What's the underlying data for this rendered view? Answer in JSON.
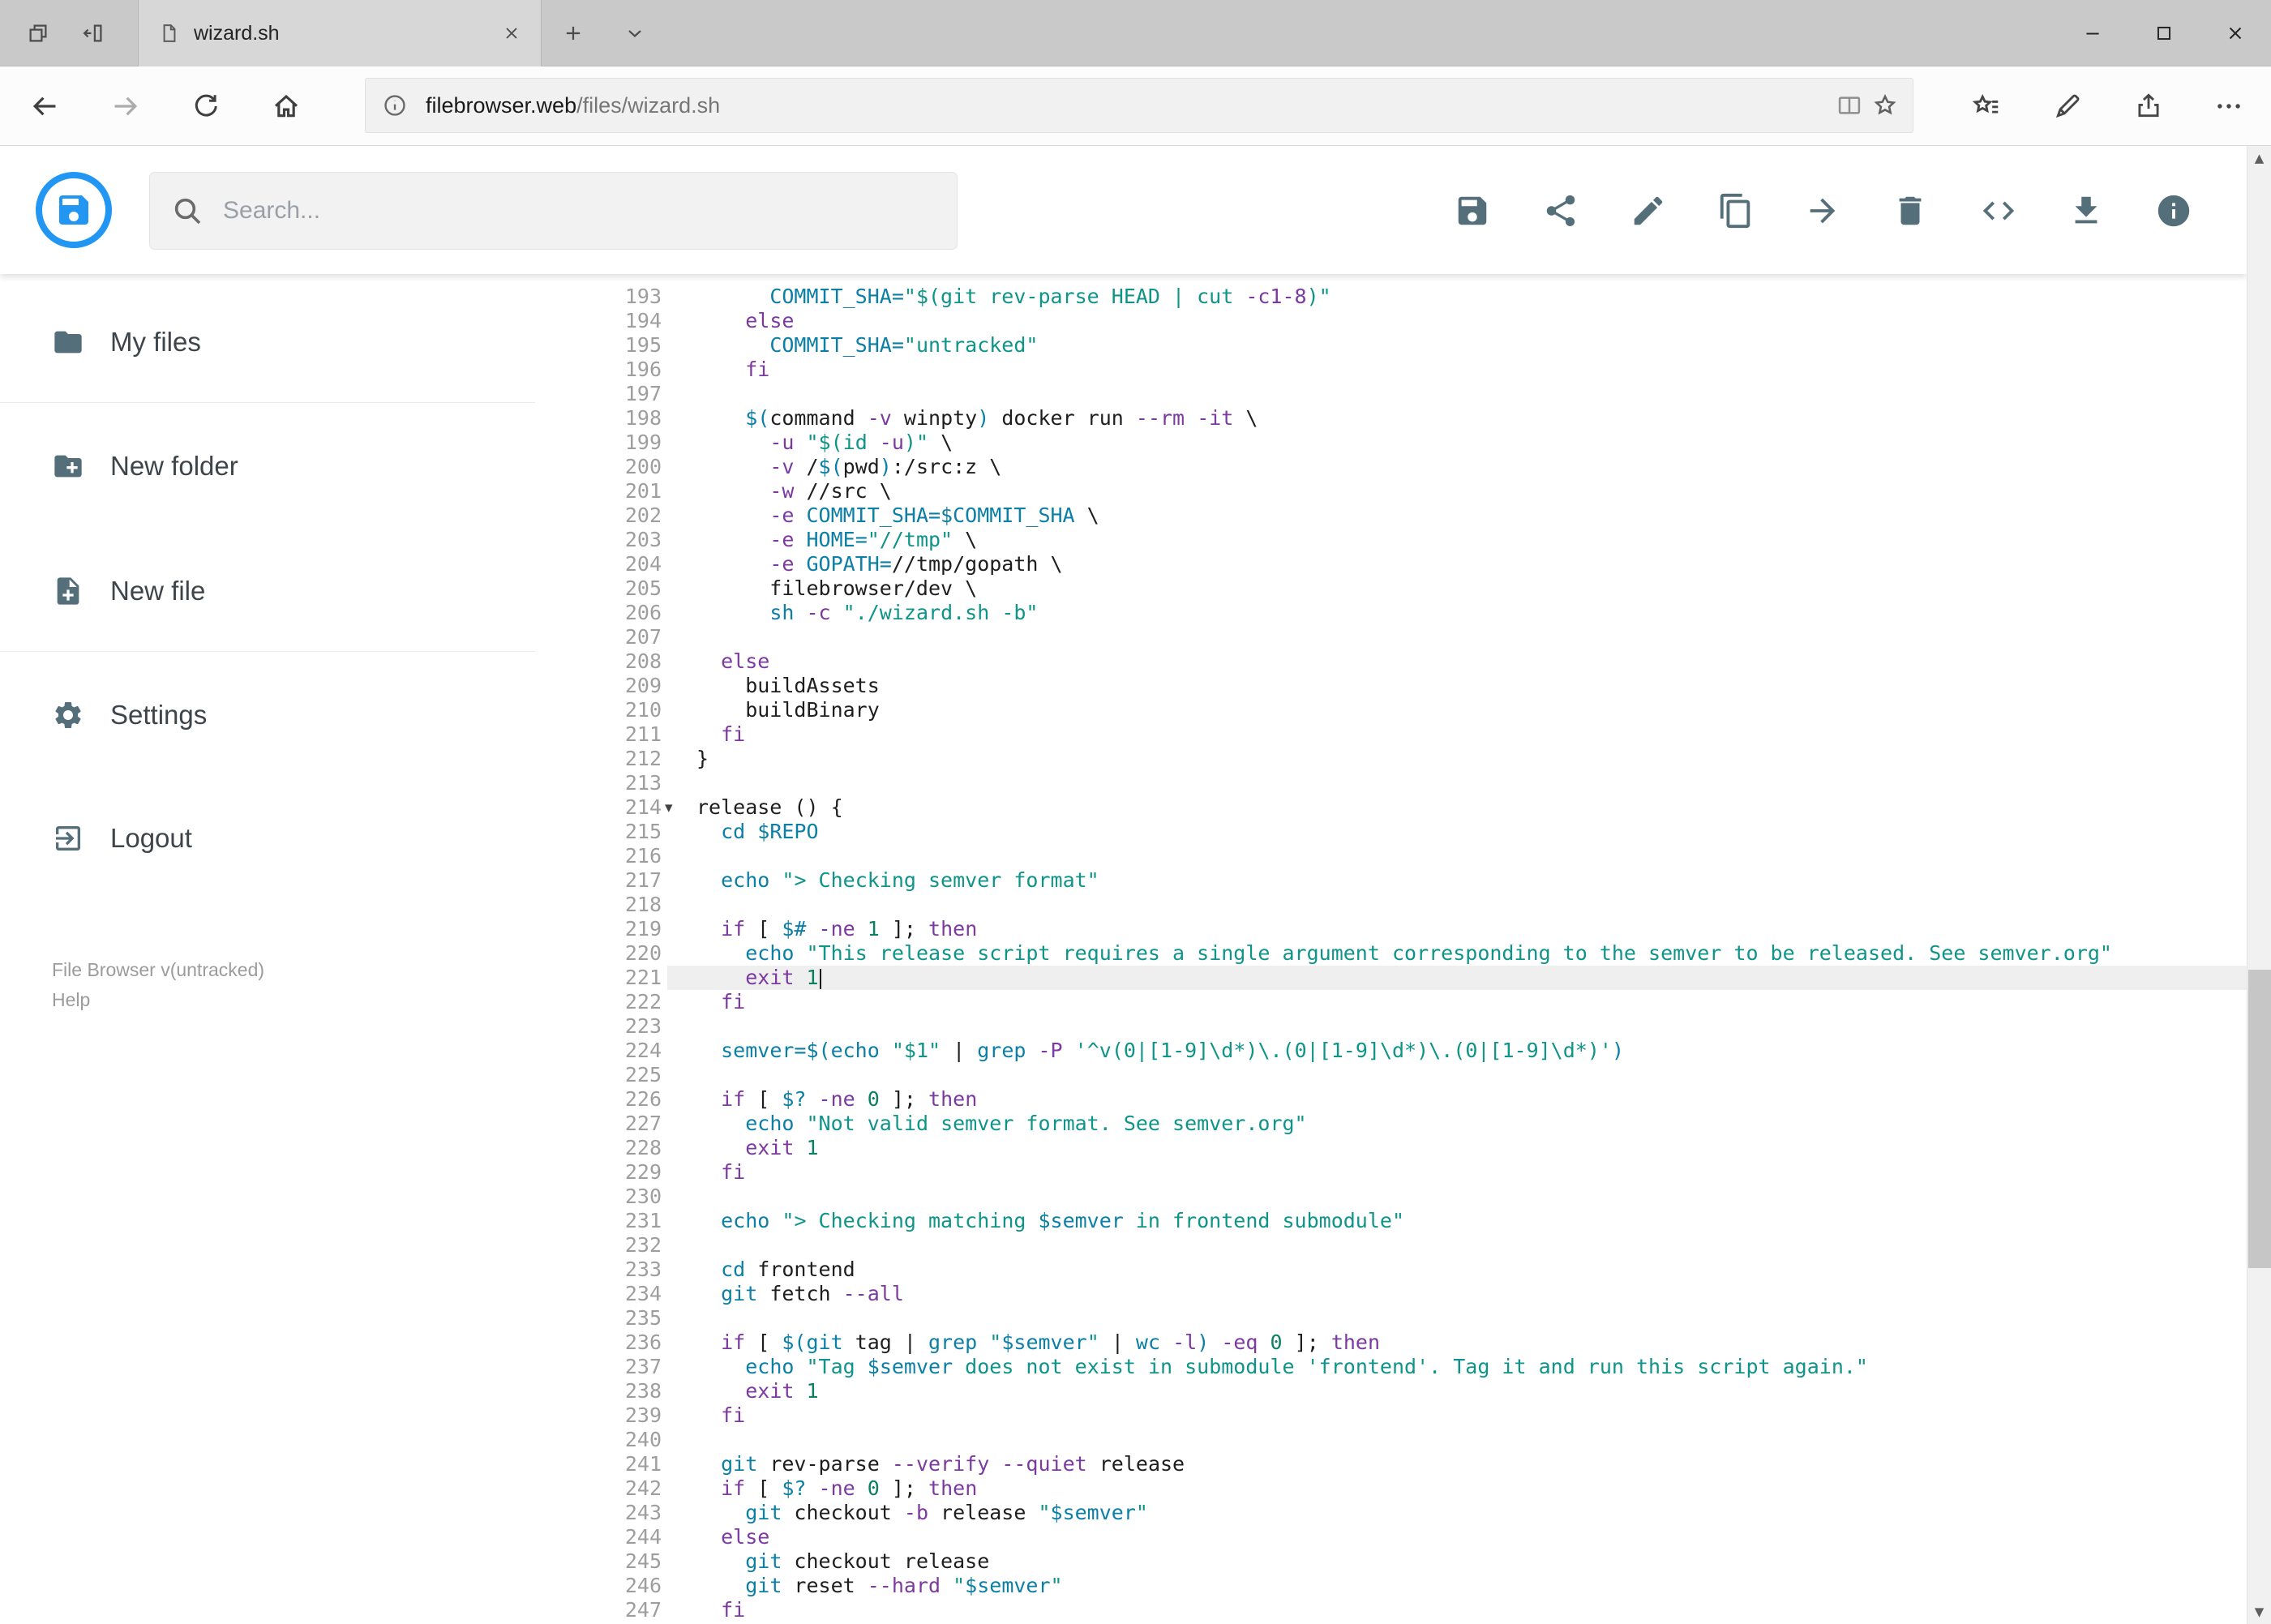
{
  "browser": {
    "tab_title": "wizard.sh",
    "url_domain": "filebrowser.web",
    "url_path": "/files/wizard.sh"
  },
  "app": {
    "search_placeholder": "Search...",
    "toolbar_icons": [
      "save",
      "share",
      "edit",
      "copy",
      "move",
      "delete",
      "raw-code",
      "download",
      "info"
    ],
    "sidebar": {
      "items": [
        {
          "label": "My files",
          "icon": "folder"
        },
        {
          "label": "New folder",
          "icon": "create-new-folder"
        },
        {
          "label": "New file",
          "icon": "new-file"
        },
        {
          "label": "Settings",
          "icon": "settings"
        },
        {
          "label": "Logout",
          "icon": "logout"
        }
      ],
      "footer_version": "File Browser v(untracked)",
      "footer_help": "Help"
    }
  },
  "colors": {
    "accent_blue": "#2196f3",
    "icon_gray": "#546e7a",
    "syntax_keyword": "#7c3aa0",
    "syntax_string": "#0f9489",
    "syntax_variable": "#0c7fa6",
    "syntax_number": "#0d7f62",
    "line_number_gray": "#9e9e9e",
    "active_line_bg": "#efefef"
  },
  "editor": {
    "active_line": 221,
    "fold_markers": [
      214
    ],
    "lines": [
      {
        "n": 193,
        "t": [
          [
            "p",
            "      "
          ],
          [
            "v",
            "COMMIT_SHA="
          ],
          [
            "s",
            "\"$(git rev-parse HEAD | cut "
          ],
          [
            "k",
            "-c1-8"
          ],
          [
            "s",
            ")\""
          ]
        ]
      },
      {
        "n": 194,
        "t": [
          [
            "p",
            "    "
          ],
          [
            "k",
            "else"
          ]
        ]
      },
      {
        "n": 195,
        "t": [
          [
            "p",
            "      "
          ],
          [
            "v",
            "COMMIT_SHA="
          ],
          [
            "s",
            "\"untracked\""
          ]
        ]
      },
      {
        "n": 196,
        "t": [
          [
            "p",
            "    "
          ],
          [
            "k",
            "fi"
          ]
        ]
      },
      {
        "n": 197,
        "t": []
      },
      {
        "n": 198,
        "t": [
          [
            "p",
            "    "
          ],
          [
            "v",
            "$("
          ],
          [
            "p",
            "command "
          ],
          [
            "k",
            "-v"
          ],
          [
            "p",
            " winpty"
          ],
          [
            "v",
            ")"
          ],
          [
            "p",
            " docker run "
          ],
          [
            "k",
            "--rm"
          ],
          [
            "p",
            " "
          ],
          [
            "k",
            "-it"
          ],
          [
            "p",
            " \\"
          ]
        ]
      },
      {
        "n": 199,
        "t": [
          [
            "p",
            "      "
          ],
          [
            "k",
            "-u"
          ],
          [
            "p",
            " "
          ],
          [
            "s",
            "\"$(id "
          ],
          [
            "k",
            "-u"
          ],
          [
            "s",
            ")\""
          ],
          [
            "p",
            " \\"
          ]
        ]
      },
      {
        "n": 200,
        "t": [
          [
            "p",
            "      "
          ],
          [
            "k",
            "-v"
          ],
          [
            "p",
            " /"
          ],
          [
            "v",
            "$("
          ],
          [
            "p",
            "pwd"
          ],
          [
            "v",
            ")"
          ],
          [
            "p",
            ":/src:z \\"
          ]
        ]
      },
      {
        "n": 201,
        "t": [
          [
            "p",
            "      "
          ],
          [
            "k",
            "-w"
          ],
          [
            "p",
            " //src \\"
          ]
        ]
      },
      {
        "n": 202,
        "t": [
          [
            "p",
            "      "
          ],
          [
            "k",
            "-e"
          ],
          [
            "p",
            " "
          ],
          [
            "v",
            "COMMIT_SHA=$COMMIT_SHA"
          ],
          [
            "p",
            " \\"
          ]
        ]
      },
      {
        "n": 203,
        "t": [
          [
            "p",
            "      "
          ],
          [
            "k",
            "-e"
          ],
          [
            "p",
            " "
          ],
          [
            "v",
            "HOME="
          ],
          [
            "s",
            "\"//tmp\""
          ],
          [
            "p",
            " \\"
          ]
        ]
      },
      {
        "n": 204,
        "t": [
          [
            "p",
            "      "
          ],
          [
            "k",
            "-e"
          ],
          [
            "p",
            " "
          ],
          [
            "v",
            "GOPATH="
          ],
          [
            "p",
            "//tmp/gopath \\"
          ]
        ]
      },
      {
        "n": 205,
        "t": [
          [
            "p",
            "      filebrowser/dev \\"
          ]
        ]
      },
      {
        "n": 206,
        "t": [
          [
            "p",
            "      "
          ],
          [
            "v",
            "sh"
          ],
          [
            "p",
            " "
          ],
          [
            "k",
            "-c"
          ],
          [
            "p",
            " "
          ],
          [
            "s",
            "\"./wizard.sh -b\""
          ]
        ]
      },
      {
        "n": 207,
        "t": []
      },
      {
        "n": 208,
        "t": [
          [
            "p",
            "  "
          ],
          [
            "k",
            "else"
          ]
        ]
      },
      {
        "n": 209,
        "t": [
          [
            "p",
            "    buildAssets"
          ]
        ]
      },
      {
        "n": 210,
        "t": [
          [
            "p",
            "    buildBinary"
          ]
        ]
      },
      {
        "n": 211,
        "t": [
          [
            "p",
            "  "
          ],
          [
            "k",
            "fi"
          ]
        ]
      },
      {
        "n": 212,
        "t": [
          [
            "p",
            "}"
          ]
        ]
      },
      {
        "n": 213,
        "t": []
      },
      {
        "n": 214,
        "t": [
          [
            "p",
            "release () {"
          ]
        ]
      },
      {
        "n": 215,
        "t": [
          [
            "p",
            "  "
          ],
          [
            "v",
            "cd $REPO"
          ]
        ]
      },
      {
        "n": 216,
        "t": []
      },
      {
        "n": 217,
        "t": [
          [
            "p",
            "  "
          ],
          [
            "v",
            "echo"
          ],
          [
            "p",
            " "
          ],
          [
            "s",
            "\"> Checking semver format\""
          ]
        ]
      },
      {
        "n": 218,
        "t": []
      },
      {
        "n": 219,
        "t": [
          [
            "p",
            "  "
          ],
          [
            "k",
            "if"
          ],
          [
            "p",
            " [ "
          ],
          [
            "v",
            "$#"
          ],
          [
            "p",
            " "
          ],
          [
            "k",
            "-ne"
          ],
          [
            "p",
            " "
          ],
          [
            "n",
            "1"
          ],
          [
            "p",
            " ]; "
          ],
          [
            "k",
            "then"
          ]
        ]
      },
      {
        "n": 220,
        "t": [
          [
            "p",
            "    "
          ],
          [
            "v",
            "echo"
          ],
          [
            "p",
            " "
          ],
          [
            "s",
            "\"This release script requires a single argument corresponding to the semver to be released. See semver.org\""
          ]
        ]
      },
      {
        "n": 221,
        "t": [
          [
            "p",
            "    "
          ],
          [
            "k",
            "exit"
          ],
          [
            "p",
            " "
          ],
          [
            "n",
            "1"
          ]
        ]
      },
      {
        "n": 222,
        "t": [
          [
            "p",
            "  "
          ],
          [
            "k",
            "fi"
          ]
        ]
      },
      {
        "n": 223,
        "t": []
      },
      {
        "n": 224,
        "t": [
          [
            "p",
            "  "
          ],
          [
            "v",
            "semver=$(echo"
          ],
          [
            "p",
            " "
          ],
          [
            "s",
            "\"$1\""
          ],
          [
            "p",
            " | "
          ],
          [
            "v",
            "grep"
          ],
          [
            "p",
            " "
          ],
          [
            "k",
            "-P"
          ],
          [
            "p",
            " "
          ],
          [
            "s",
            "'^v(0|[1-9]\\d*)\\.(0|[1-9]\\d*)\\.(0|[1-9]\\d*)'"
          ],
          [
            "v",
            ")"
          ]
        ]
      },
      {
        "n": 225,
        "t": []
      },
      {
        "n": 226,
        "t": [
          [
            "p",
            "  "
          ],
          [
            "k",
            "if"
          ],
          [
            "p",
            " [ "
          ],
          [
            "v",
            "$?"
          ],
          [
            "p",
            " "
          ],
          [
            "k",
            "-ne"
          ],
          [
            "p",
            " "
          ],
          [
            "n",
            "0"
          ],
          [
            "p",
            " ]; "
          ],
          [
            "k",
            "then"
          ]
        ]
      },
      {
        "n": 227,
        "t": [
          [
            "p",
            "    "
          ],
          [
            "v",
            "echo"
          ],
          [
            "p",
            " "
          ],
          [
            "s",
            "\"Not valid semver format. See semver.org\""
          ]
        ]
      },
      {
        "n": 228,
        "t": [
          [
            "p",
            "    "
          ],
          [
            "k",
            "exit"
          ],
          [
            "p",
            " "
          ],
          [
            "n",
            "1"
          ]
        ]
      },
      {
        "n": 229,
        "t": [
          [
            "p",
            "  "
          ],
          [
            "k",
            "fi"
          ]
        ]
      },
      {
        "n": 230,
        "t": []
      },
      {
        "n": 231,
        "t": [
          [
            "p",
            "  "
          ],
          [
            "v",
            "echo"
          ],
          [
            "p",
            " "
          ],
          [
            "s",
            "\"> Checking matching "
          ],
          [
            "v",
            "$semver"
          ],
          [
            "s",
            " in frontend submodule\""
          ]
        ]
      },
      {
        "n": 232,
        "t": []
      },
      {
        "n": 233,
        "t": [
          [
            "p",
            "  "
          ],
          [
            "v",
            "cd"
          ],
          [
            "p",
            " frontend"
          ]
        ]
      },
      {
        "n": 234,
        "t": [
          [
            "p",
            "  "
          ],
          [
            "v",
            "git"
          ],
          [
            "p",
            " fetch "
          ],
          [
            "k",
            "--all"
          ]
        ]
      },
      {
        "n": 235,
        "t": []
      },
      {
        "n": 236,
        "t": [
          [
            "p",
            "  "
          ],
          [
            "k",
            "if"
          ],
          [
            "p",
            " [ "
          ],
          [
            "v",
            "$(git"
          ],
          [
            "p",
            " tag | "
          ],
          [
            "v",
            "grep"
          ],
          [
            "p",
            " "
          ],
          [
            "s",
            "\""
          ],
          [
            "v",
            "$semver"
          ],
          [
            "s",
            "\""
          ],
          [
            "p",
            " | "
          ],
          [
            "v",
            "wc"
          ],
          [
            "p",
            " "
          ],
          [
            "k",
            "-l"
          ],
          [
            "v",
            ")"
          ],
          [
            "p",
            " "
          ],
          [
            "k",
            "-eq"
          ],
          [
            "p",
            " "
          ],
          [
            "n",
            "0"
          ],
          [
            "p",
            " ]; "
          ],
          [
            "k",
            "then"
          ]
        ]
      },
      {
        "n": 237,
        "t": [
          [
            "p",
            "    "
          ],
          [
            "v",
            "echo"
          ],
          [
            "p",
            " "
          ],
          [
            "s",
            "\"Tag "
          ],
          [
            "v",
            "$semver"
          ],
          [
            "s",
            " does not exist in submodule 'frontend'. Tag it and run this script again.\""
          ]
        ]
      },
      {
        "n": 238,
        "t": [
          [
            "p",
            "    "
          ],
          [
            "k",
            "exit"
          ],
          [
            "p",
            " "
          ],
          [
            "n",
            "1"
          ]
        ]
      },
      {
        "n": 239,
        "t": [
          [
            "p",
            "  "
          ],
          [
            "k",
            "fi"
          ]
        ]
      },
      {
        "n": 240,
        "t": []
      },
      {
        "n": 241,
        "t": [
          [
            "p",
            "  "
          ],
          [
            "v",
            "git"
          ],
          [
            "p",
            " rev-parse "
          ],
          [
            "k",
            "--verify"
          ],
          [
            "p",
            " "
          ],
          [
            "k",
            "--quiet"
          ],
          [
            "p",
            " release"
          ]
        ]
      },
      {
        "n": 242,
        "t": [
          [
            "p",
            "  "
          ],
          [
            "k",
            "if"
          ],
          [
            "p",
            " [ "
          ],
          [
            "v",
            "$?"
          ],
          [
            "p",
            " "
          ],
          [
            "k",
            "-ne"
          ],
          [
            "p",
            " "
          ],
          [
            "n",
            "0"
          ],
          [
            "p",
            " ]; "
          ],
          [
            "k",
            "then"
          ]
        ]
      },
      {
        "n": 243,
        "t": [
          [
            "p",
            "    "
          ],
          [
            "v",
            "git"
          ],
          [
            "p",
            " checkout "
          ],
          [
            "k",
            "-b"
          ],
          [
            "p",
            " release "
          ],
          [
            "s",
            "\""
          ],
          [
            "v",
            "$semver"
          ],
          [
            "s",
            "\""
          ]
        ]
      },
      {
        "n": 244,
        "t": [
          [
            "p",
            "  "
          ],
          [
            "k",
            "else"
          ]
        ]
      },
      {
        "n": 245,
        "t": [
          [
            "p",
            "    "
          ],
          [
            "v",
            "git"
          ],
          [
            "p",
            " checkout release"
          ]
        ]
      },
      {
        "n": 246,
        "t": [
          [
            "p",
            "    "
          ],
          [
            "v",
            "git"
          ],
          [
            "p",
            " reset "
          ],
          [
            "k",
            "--hard"
          ],
          [
            "p",
            " "
          ],
          [
            "s",
            "\""
          ],
          [
            "v",
            "$semver"
          ],
          [
            "s",
            "\""
          ]
        ]
      },
      {
        "n": 247,
        "t": [
          [
            "p",
            "  "
          ],
          [
            "k",
            "fi"
          ]
        ]
      }
    ]
  }
}
